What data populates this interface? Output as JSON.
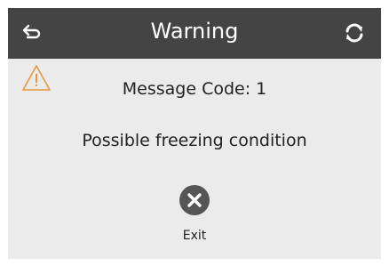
{
  "header": {
    "title": "Warning",
    "back_icon": "back-arrow-icon",
    "refresh_icon": "refresh-icon",
    "background": "#444444"
  },
  "warning": {
    "icon": "warning-triangle-icon",
    "icon_color": "#e8973a"
  },
  "message": {
    "code": "Message Code: 1",
    "text": "Possible freezing condition"
  },
  "exit_button": {
    "icon": "close-circle-icon",
    "label": "Exit",
    "icon_color": "#555555"
  }
}
